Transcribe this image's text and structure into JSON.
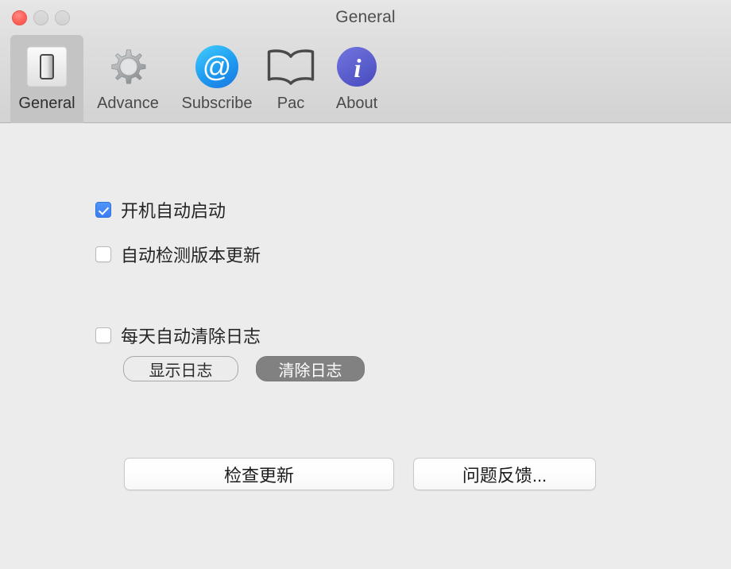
{
  "window": {
    "title": "General",
    "traffic_lights": [
      {
        "name": "close",
        "label": "Close",
        "color": "#ff6159",
        "state": "active"
      },
      {
        "name": "minimize",
        "label": "Minimize",
        "color": "#d6d6d6",
        "state": "disabled"
      },
      {
        "name": "zoom",
        "label": "Zoom",
        "color": "#d6d6d6",
        "state": "disabled"
      }
    ]
  },
  "toolbar": {
    "tabs": [
      {
        "id": "general",
        "label": "General",
        "icon": "light-switch-icon",
        "selected": true
      },
      {
        "id": "advance",
        "label": "Advance",
        "icon": "gear-icon",
        "selected": false
      },
      {
        "id": "subscribe",
        "label": "Subscribe",
        "icon": "at-sign-icon",
        "selected": false
      },
      {
        "id": "pac",
        "label": "Pac",
        "icon": "open-book-icon",
        "selected": false
      },
      {
        "id": "about",
        "label": "About",
        "icon": "info-circle-icon",
        "selected": false
      }
    ]
  },
  "content": {
    "checkboxes": [
      {
        "id": "launch-at-login",
        "label": "开机自动启动",
        "checked": true
      },
      {
        "id": "auto-check-update",
        "label": "自动检测版本更新",
        "checked": false
      },
      {
        "id": "daily-clear-log",
        "label": "每天自动清除日志",
        "checked": false
      }
    ],
    "log_buttons": [
      {
        "id": "show-log",
        "label": "显示日志",
        "style": "light"
      },
      {
        "id": "clear-log",
        "label": "清除日志",
        "style": "dark"
      }
    ],
    "action_buttons": [
      {
        "id": "check-update",
        "label": "检查更新"
      },
      {
        "id": "feedback",
        "label": "问题反馈..."
      }
    ]
  },
  "colors": {
    "toolbar_top": "#e6e6e6",
    "toolbar_bottom": "#d3d3d3",
    "content_bg": "#ececec",
    "selected_tab_bg": "#c4c4c4",
    "checkbox_accent": "#3b7df3",
    "dark_pill_bg": "#818181",
    "at_icon_blue": "#1a8ae8",
    "info_icon_purple": "#5659cb"
  }
}
